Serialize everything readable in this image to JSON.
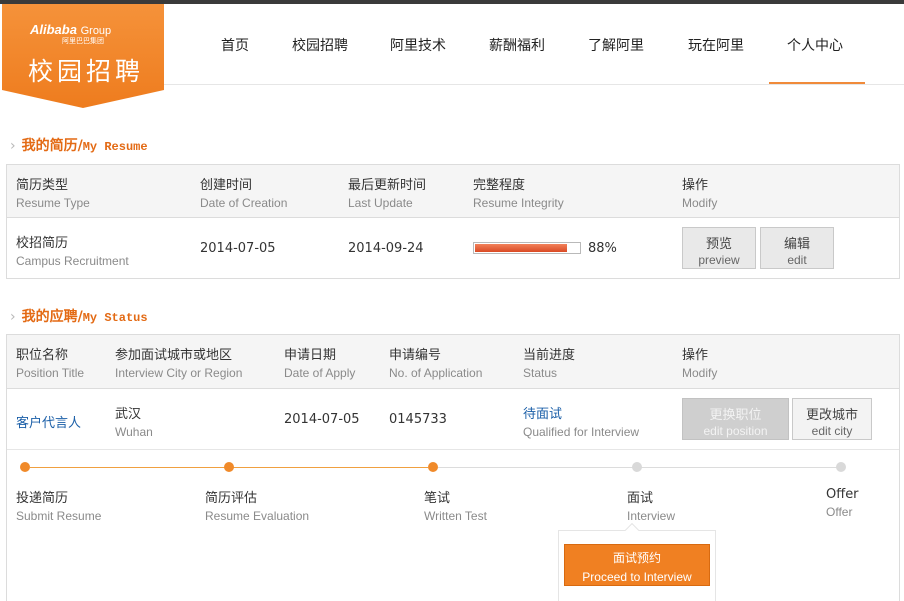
{
  "header": {
    "logo_brand": "Alibaba",
    "logo_group": "Group",
    "logo_sub": "阿里巴巴集团",
    "logo_title": "校园招聘",
    "colors": {
      "brand": "#f08022",
      "accent": "#e36a14",
      "link": "#1b5fa8"
    }
  },
  "nav": {
    "items": [
      {
        "label": "首页"
      },
      {
        "label": "校园招聘"
      },
      {
        "label": "阿里技术"
      },
      {
        "label": "薪酬福利"
      },
      {
        "label": "了解阿里"
      },
      {
        "label": "玩在阿里"
      },
      {
        "label": "个人中心",
        "active": true
      }
    ]
  },
  "resume": {
    "section_title_zh": "我的简历/",
    "section_title_en": "My Resume",
    "columns": [
      {
        "zh": "简历类型",
        "en": "Resume Type"
      },
      {
        "zh": "创建时间",
        "en": "Date of Creation"
      },
      {
        "zh": "最后更新时间",
        "en": "Last Update"
      },
      {
        "zh": "完整程度",
        "en": "Resume Integrity"
      },
      {
        "zh": "操作",
        "en": "Modify"
      }
    ],
    "row": {
      "type_zh": "校招简历",
      "type_en": "Campus Recruitment",
      "created": "2014-07-05",
      "updated": "2014-09-24",
      "integrity": 0.88,
      "integrity_text": "88%",
      "preview_zh": "预览",
      "preview_en": "preview",
      "edit_zh": "编辑",
      "edit_en": "edit"
    }
  },
  "status": {
    "section_title_zh": "我的应聘/",
    "section_title_en": "My Status",
    "columns": [
      {
        "zh": "职位名称",
        "en": "Position Title"
      },
      {
        "zh": "参加面试城市或地区",
        "en": "Interview City or Region"
      },
      {
        "zh": "申请日期",
        "en": "Date of Apply"
      },
      {
        "zh": "申请编号",
        "en": "No. of Application"
      },
      {
        "zh": "当前进度",
        "en": "Status"
      },
      {
        "zh": "操作",
        "en": "Modify"
      }
    ],
    "row": {
      "position": "客户代言人",
      "city_zh": "武汉",
      "city_en": "Wuhan",
      "date": "2014-07-05",
      "app_no": "0145733",
      "status_zh": "待面试",
      "status_en": "Qualified for Interview",
      "edit_position_zh": "更换职位",
      "edit_position_en": "edit position",
      "edit_city_zh": "更改城市",
      "edit_city_en": "edit city"
    },
    "steps": [
      {
        "zh": "投递简历",
        "en": "Submit Resume",
        "done": true
      },
      {
        "zh": "简历评估",
        "en": "Resume Evaluation",
        "done": true
      },
      {
        "zh": "笔试",
        "en": "Written Test",
        "done": true
      },
      {
        "zh": "面试",
        "en": "Interview",
        "done": false
      },
      {
        "zh": "Offer",
        "en": "Offer",
        "done": false
      }
    ],
    "proceed_zh": "面试预约",
    "proceed_en": "Proceed to Interview"
  }
}
